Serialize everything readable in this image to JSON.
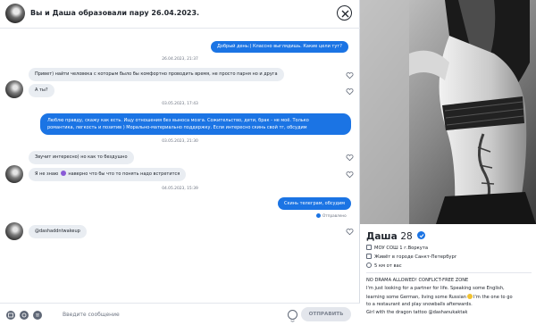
{
  "chat": {
    "title": "Вы и Даша образовали пару 26.04.2023.",
    "messages": [
      {
        "dir": "out",
        "text": "Добрый день:) Классно выглядишь. Какие цели тут?"
      },
      {
        "kind": "timestamp",
        "text": "26.04.2023, 21:37"
      },
      {
        "dir": "in",
        "text": "Привет) найти человека с которым было бы комфортно проводить время, не просто парня но и друга"
      },
      {
        "dir": "in",
        "text": "А ты?"
      },
      {
        "kind": "timestamp",
        "text": "03.05.2023, 17:43"
      },
      {
        "dir": "out",
        "lines": [
          "Люблю правду, скажу как есть. Ищу отношения без выноса мозга. Сожительство, дети, брак - не моё. Только",
          "романтика, легкость и позитив ) Морально-материально поддержку. Если интересно скинь свой тг, обсудим"
        ]
      },
      {
        "kind": "timestamp",
        "text": "03.05.2023, 21:30"
      },
      {
        "dir": "in",
        "text": "Звучит интересно) но как то бездушно"
      },
      {
        "dir": "in",
        "text_before": "Я не знаю",
        "text_after": "наверно что бы что то понять надо встретится"
      },
      {
        "kind": "timestamp",
        "text": "04.05.2023, 15:39"
      },
      {
        "dir": "out",
        "text": "Скинь телеграм, обсудим"
      },
      {
        "dir": "in",
        "text": "@dashaddntwakeup"
      }
    ],
    "delivered_label": "Отправлено",
    "composer": {
      "placeholder": "Введите сообщение",
      "send_label": "ОТПРАВИТЬ",
      "icons": [
        "gif-icon",
        "sticker-icon",
        "spotify-icon",
        "emoji-icon"
      ]
    }
  },
  "profile": {
    "name": "Даша",
    "age": "28",
    "verified": true,
    "school": "МОУ СОШ 1 г.Воркута",
    "lives": "Живёт в городе Санкт-Петербург",
    "distance": "5 км от вас",
    "bio": [
      "NO DRAMA ALLOWED! CONFLICT-FREE ZONE",
      "I'm just looking for a partner for life. Speaking some English,",
      "learning some German, living some Russian",
      "I'm the one to go",
      "to a restaurant and play snowballs afterwards.",
      "Girl with the dragon tattoo @dashanukaktak"
    ]
  },
  "colors": {
    "accent": "#1b74e4",
    "bubble_in": "#e9edf2",
    "text": "#21262e",
    "muted": "#6d7482"
  }
}
